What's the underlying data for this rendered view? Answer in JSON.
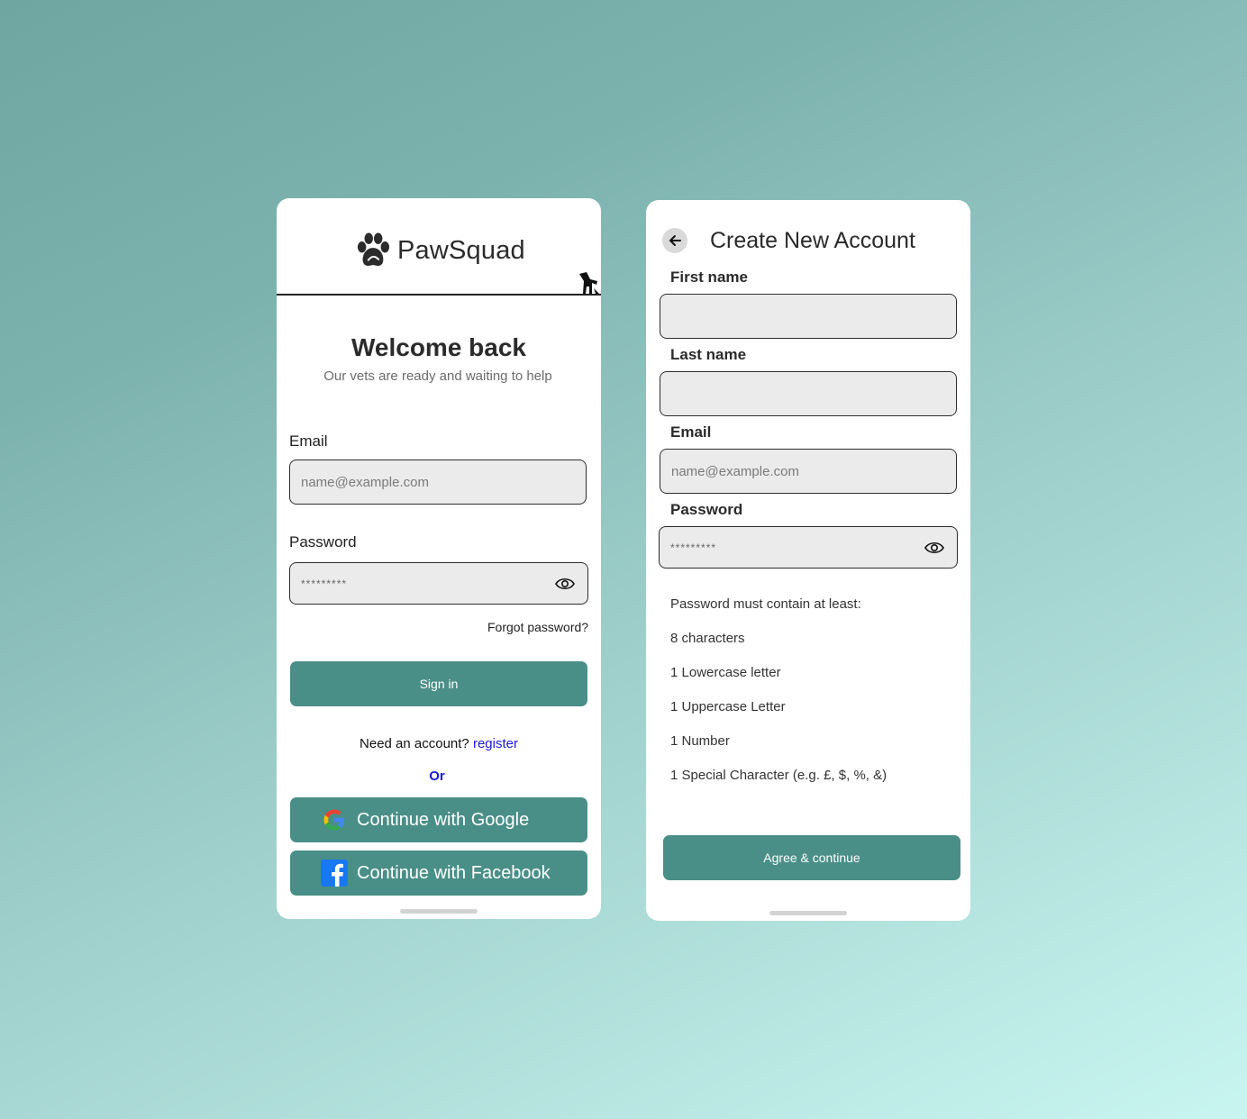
{
  "login": {
    "brand": "PawSquad",
    "title": "Welcome back",
    "subtitle": "Our vets are ready and waiting to help",
    "email_label": "Email",
    "email_placeholder": "name@example.com",
    "password_label": "Password",
    "password_placeholder": "*********",
    "forgot": "Forgot password?",
    "signin": "Sign in",
    "need_account": "Need an account?",
    "register_link": "register",
    "or": "Or",
    "google": "Continue with Google",
    "facebook": "Continue with Facebook"
  },
  "register": {
    "title": "Create New Account",
    "first_name_label": "First name",
    "last_name_label": "Last name",
    "email_label": "Email",
    "email_placeholder": "name@example.com",
    "password_label": "Password",
    "password_placeholder": "*********",
    "requirements_heading": "Password must contain at least:",
    "requirements": [
      "8 characters",
      "1 Lowercase letter",
      "1 Uppercase Letter",
      "1 Number",
      "1 Special Character (e.g. £, $, %, &)"
    ],
    "agree": "Agree & continue"
  },
  "colors": {
    "accent": "#4a8f87",
    "link": "#1a1ad6",
    "field_bg": "#ebebeb"
  },
  "icons": [
    "paw-logo-icon",
    "dog-cat-icon",
    "eye-icon",
    "google-icon",
    "facebook-icon",
    "back-arrow-icon"
  ]
}
